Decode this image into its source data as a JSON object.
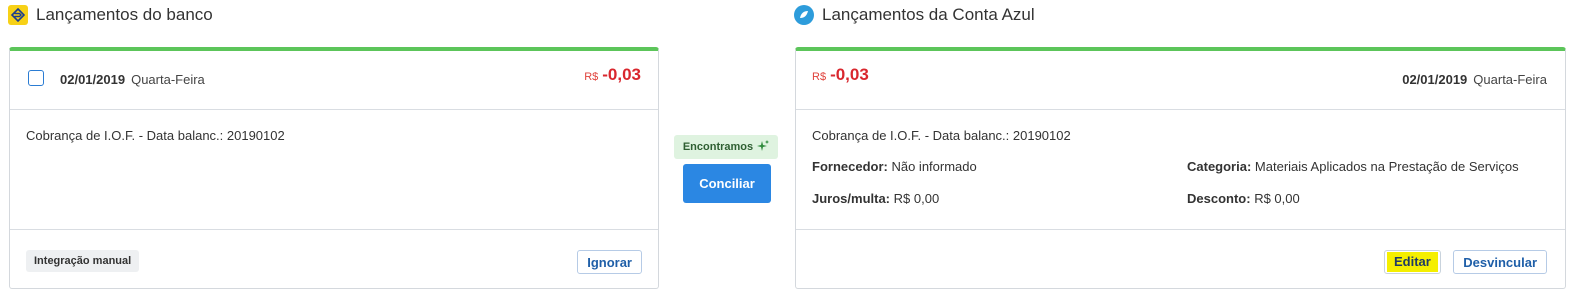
{
  "bank": {
    "title": "Lançamentos do banco",
    "date": "02/01/2019",
    "weekday": "Quarta-Feira",
    "currency": "R$",
    "amount": "-0,03",
    "description": "Cobrança de I.O.F. - Data balanc.: 20190102",
    "tag": "Integração manual",
    "ignore_label": "Ignorar"
  },
  "match": {
    "badge": "Encontramos",
    "button": "Conciliar"
  },
  "conta_azul": {
    "title": "Lançamentos da Conta Azul",
    "currency": "R$",
    "amount": "-0,03",
    "date": "02/01/2019",
    "weekday": "Quarta-Feira",
    "description": "Cobrança de I.O.F. - Data balanc.: 20190102",
    "fornecedor_label": "Fornecedor:",
    "fornecedor_value": "Não informado",
    "categoria_label": "Categoria:",
    "categoria_value": "Materiais Aplicados na Prestação de Serviços",
    "juros_label": "Juros/multa:",
    "juros_value": "R$ 0,00",
    "desconto_label": "Desconto:",
    "desconto_value": "R$ 0,00",
    "edit_label": "Editar",
    "unlink_label": "Desvincular"
  },
  "colors": {
    "accent_green": "#5cc55a",
    "amount_red": "#d9272e",
    "primary_blue": "#2b87e3",
    "highlight_yellow": "#f5ef00"
  }
}
